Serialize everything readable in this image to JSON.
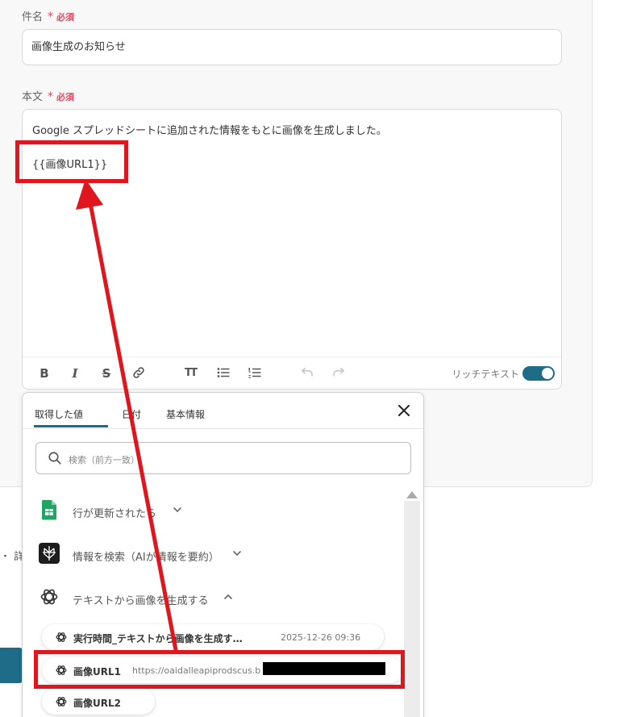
{
  "form": {
    "subject_label": "件名",
    "required_label": "必須",
    "subject_value": "画像生成のお知らせ",
    "body_label": "本文",
    "body_line1": "Google スプレッドシートに追加された情報をもとに画像を生成しました。",
    "body_line2": "{{画像URL1}}",
    "toolbar": {
      "bold": "B",
      "italic": "I",
      "strike": "S",
      "heading": "TT",
      "rich_text_label": "リッチテキスト",
      "rich_text_enabled": true
    }
  },
  "popup": {
    "tabs": [
      "取得した値",
      "日付",
      "基本情報"
    ],
    "active_tab": 0,
    "search_placeholder": "検索（前方一致）",
    "groups": [
      {
        "label": "行が更新されたら",
        "icon": "google-sheets-icon",
        "expanded": false
      },
      {
        "label": "情報を検索（AIが情報を要約）",
        "icon": "perplexity-icon",
        "expanded": false
      },
      {
        "label": "テキストから画像を生成する",
        "icon": "openai-icon",
        "expanded": true
      }
    ],
    "items": [
      {
        "name": "実行時間_テキストから画像を生成す…",
        "value": "2025-12-26 09:36"
      },
      {
        "name": "画像URL1",
        "value": "https://oaidalleapiprodscus.b"
      },
      {
        "name": "画像URL2",
        "value": ""
      }
    ]
  },
  "background": {
    "partial_text": "・ 詳"
  },
  "colors": {
    "accent": "#1f6c88",
    "required": "#e0455f",
    "annotation": "#e0161e",
    "sheets_green": "#21a464"
  }
}
